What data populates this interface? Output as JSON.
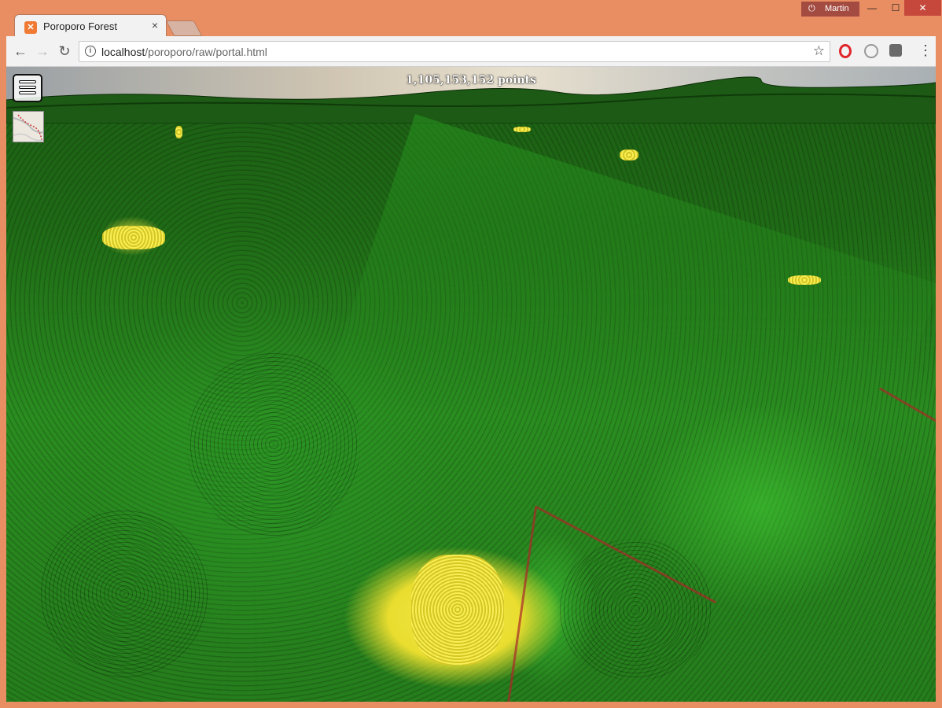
{
  "window": {
    "profile_name": "Martin",
    "controls": {
      "minimize": "—",
      "maximize": "☐",
      "close": "✕"
    }
  },
  "tab": {
    "title": "Poroporo Forest",
    "favicon_icon": "xampp-icon",
    "close": "×"
  },
  "toolbar": {
    "back_icon": "←",
    "forward_icon": "→",
    "reload_icon": "↻",
    "url_host": "localhost",
    "url_path": "/poroporo/raw/portal.html",
    "bookmark_icon": "☆",
    "menu_icon": "⋮"
  },
  "viewer": {
    "point_count": "1,105,153,152 points",
    "colors": {
      "vegetation_dark": "#1c5d14",
      "vegetation_light": "#4bd13a",
      "highlight": "#f2e84a",
      "trail": "#a82828"
    }
  }
}
